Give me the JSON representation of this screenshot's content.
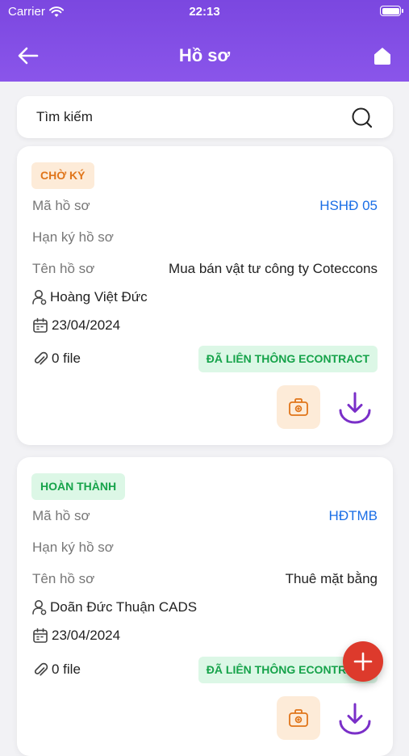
{
  "status_bar": {
    "carrier": "Carrier",
    "time": "22:13"
  },
  "header": {
    "title": "Hồ sơ"
  },
  "search": {
    "placeholder": "Tìm kiếm"
  },
  "labels": {
    "code": "Mã hồ sơ",
    "deadline": "Hạn ký hồ sơ",
    "name": "Tên hồ sơ"
  },
  "records": [
    {
      "status": "CHỜ KÝ",
      "code": "HSHĐ 05",
      "deadline": "",
      "name": "Mua bán vật tư công ty Coteccons",
      "owner": "Hoàng Việt Đức",
      "date": "23/04/2024",
      "files": "0 file",
      "sync": "ĐÃ LIÊN THÔNG ECONTRACT"
    },
    {
      "status": "HOÀN THÀNH",
      "code": "HĐTMB",
      "deadline": "",
      "name": "Thuê mặt bằng",
      "owner": "Doãn Đức Thuận CADS",
      "date": "23/04/2024",
      "files": "0 file",
      "sync": "ĐÃ LIÊN THÔNG ECONTRACT"
    }
  ],
  "colors": {
    "header": "#7b47e0",
    "pending": "#e0751a",
    "done": "#16a34a",
    "link": "#1a6ee6",
    "download": "#7a2fc8",
    "fab": "#dd3a2c"
  }
}
